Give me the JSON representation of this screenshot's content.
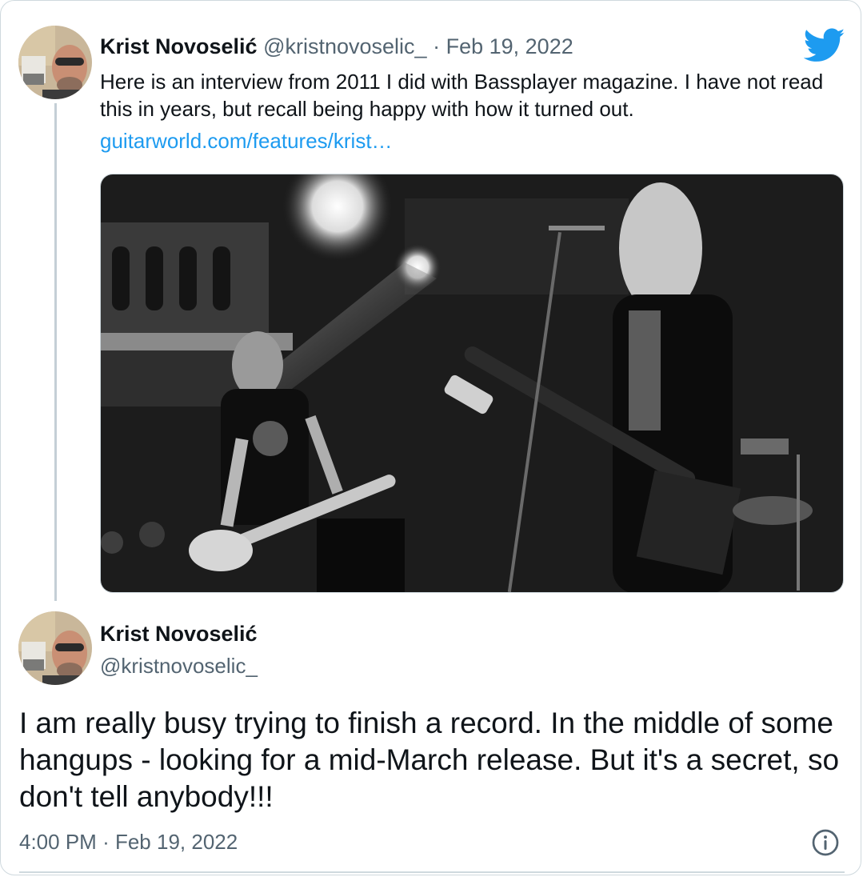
{
  "parent_tweet": {
    "author_name": "Krist Novoselić",
    "handle": "@kristnovoselic_",
    "separator": "·",
    "date": "Feb 19, 2022",
    "text": "Here is an interview from 2011 I did with Bassplayer magazine. I have not read this in years, but recall being happy with how it turned out.",
    "link": "guitarworld.com/features/krist…",
    "media_icon": "concert-photo"
  },
  "main_tweet": {
    "author_name": "Krist Novoselić",
    "handle": "@kristnovoselic_",
    "text": "I am really busy trying to finish a record. In the middle of some hangups - looking for a mid-March release. But it's a secret, so don't tell anybody!!!",
    "time": "4:00 PM",
    "separator": "·",
    "date": "Feb 19, 2022"
  },
  "icons": {
    "brand": "twitter-bird-icon",
    "info": "info-icon"
  },
  "colors": {
    "link": "#1d9bf0",
    "secondary_text": "#536471",
    "primary_text": "#0f1419",
    "border": "#cfd9de"
  }
}
